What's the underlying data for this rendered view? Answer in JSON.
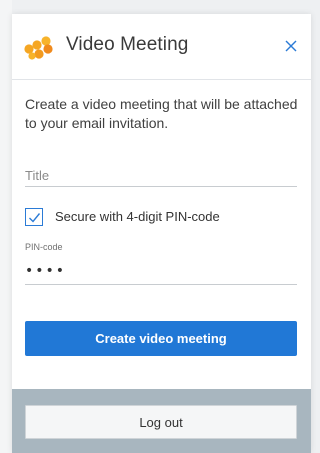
{
  "header": {
    "title": "Video Meeting",
    "logo_icon": "app-logo-icon",
    "close_icon": "close-icon",
    "logo_color": "#f5a623"
  },
  "main": {
    "description": "Create a video meeting that will be attached to your email invitation.",
    "title_field": {
      "placeholder": "Title",
      "value": ""
    },
    "secure_checkbox": {
      "label": "Secure with 4-digit PIN-code",
      "checked": true
    },
    "pin_field": {
      "label": "PIN-code",
      "value": "••••"
    },
    "create_button_label": "Create video meeting"
  },
  "footer": {
    "logout_label": "Log out"
  },
  "colors": {
    "accent": "#2178d6",
    "footer_bg": "#a8b6bf"
  }
}
